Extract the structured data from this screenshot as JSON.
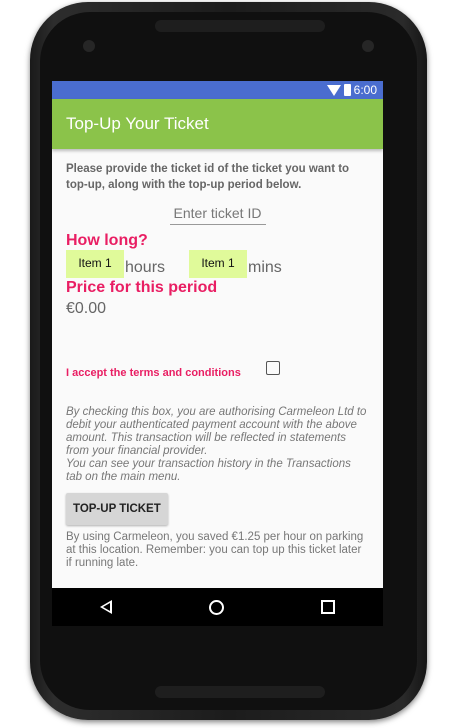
{
  "status_bar": {
    "time": "6:00"
  },
  "app_bar": {
    "title": "Top-Up Your Ticket"
  },
  "form": {
    "instructions": "Please provide the ticket id of the ticket you want to top-up, along with the top-up period below.",
    "ticket_id": {
      "placeholder": "Enter ticket ID",
      "value": ""
    },
    "how_long_title": "How long?",
    "hours_spinner": "Item 1",
    "hours_label": "hours",
    "mins_spinner": "Item 1",
    "mins_label": "mins",
    "price_title": "Price for this period",
    "price_value": "€0.00",
    "terms_label": "I accept the terms and conditions",
    "terms_checked": false,
    "disclaimer_lines": [
      "By checking this box, you are authorising Carmeleon Ltd to debit your authenticated payment account with the above amount. This transaction will be reflected in statements from your financial provider.",
      "You can see your transaction history in the Transactions tab on the main menu."
    ],
    "topup_button": "TOP-UP TICKET",
    "footer_note": "By using Carmeleon, you saved €1.25 per hour on parking at this location. Remember: you can top up this ticket later if running late."
  },
  "colors": {
    "app_bar": "#8bc34a",
    "status_bar": "#4a6dcf",
    "accent_pink": "#e91e63",
    "spinner_bg": "#e0fa9a"
  },
  "nav_bar": {
    "icons": [
      "back-icon",
      "home-icon",
      "recents-icon"
    ]
  }
}
